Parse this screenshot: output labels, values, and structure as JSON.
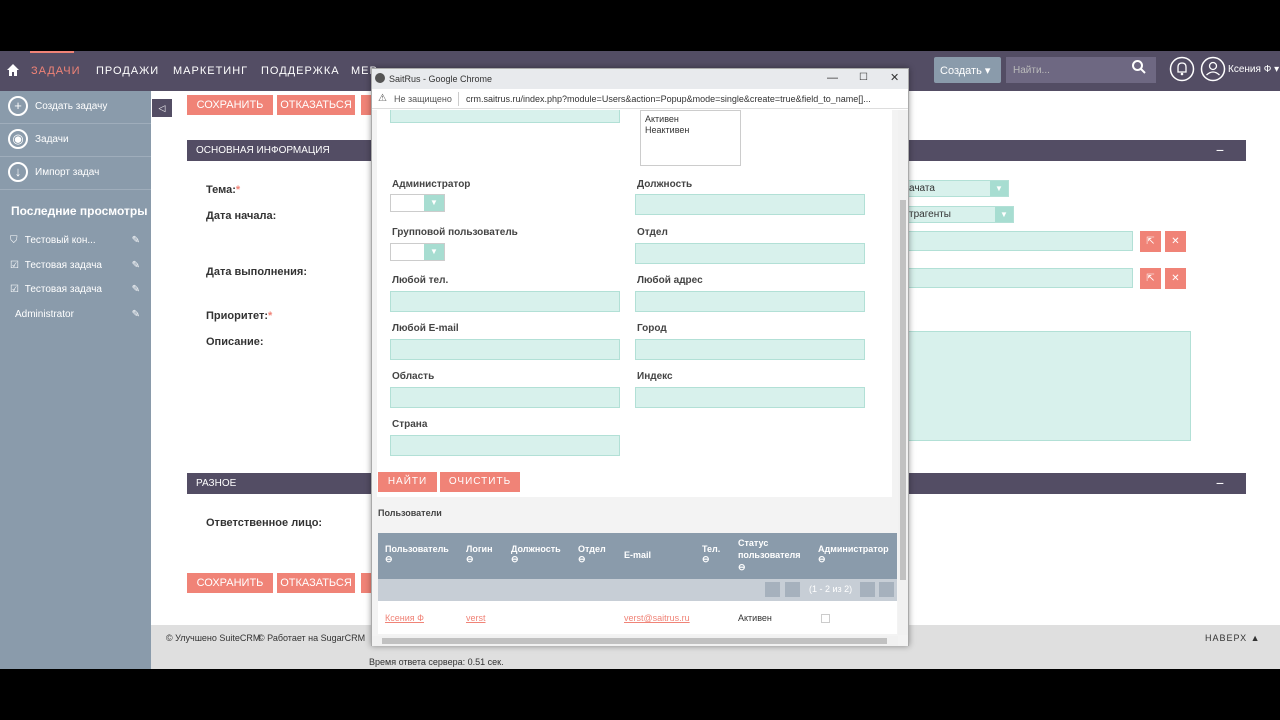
{
  "nav": {
    "items": [
      "ЗАДАЧИ",
      "ПРОДАЖИ",
      "МАРКЕТИНГ",
      "ПОДДЕРЖКА",
      "МЕР"
    ],
    "create_label": "Создать",
    "search_placeholder": "Найти...",
    "user_name": "Ксения Ф"
  },
  "sidebar": {
    "actions": [
      {
        "label": "Создать задачу",
        "icon": "plus-icon"
      },
      {
        "label": "Задачи",
        "icon": "eye-icon"
      },
      {
        "label": "Импорт задач",
        "icon": "download-icon"
      }
    ],
    "recent_title": "Последние просмотры",
    "recent": [
      {
        "label": "Тестовый кон...",
        "icon": "shield-icon"
      },
      {
        "label": "Тестовая задача",
        "icon": "check-icon"
      },
      {
        "label": "Тестовая задача",
        "icon": "check-icon"
      },
      {
        "label": "Administrator",
        "icon": ""
      }
    ]
  },
  "form": {
    "save_label": "СОХРАНИТЬ",
    "cancel_label": "ОТКАЗАТЬСЯ",
    "panel_main": "ОСНОВНАЯ ИНФОРМАЦИЯ",
    "panel_misc": "РАЗНОЕ",
    "labels": {
      "subject": "Тема:",
      "date_start": "Дата начала:",
      "date_due": "Дата выполнения:",
      "priority": "Приоритет:",
      "description": "Описание:",
      "assigned": "Ответственное лицо:"
    },
    "status_value": "ачата",
    "parent_type_value": "трагенты"
  },
  "footer": {
    "left1": "© Улучшено SuiteCRM",
    "left2": "© Работает на SugarCRM",
    "top_label": "НАВЕРХ",
    "server_time": "Время ответа сервера: 0.51 сек."
  },
  "popup": {
    "window_title": "SaitRus - Google Chrome",
    "insecure_label": "Не защищено",
    "url": "crm.saitrus.ru/index.php?module=Users&action=Popup&mode=single&create=true&field_to_name[]...",
    "status_options": [
      "Активен",
      "Неактивен"
    ],
    "labels": {
      "admin": "Администратор",
      "title": "Должность",
      "group_user": "Групповой пользователь",
      "department": "Отдел",
      "any_phone": "Любой тел.",
      "any_address": "Любой адрес",
      "any_email": "Любой E-mail",
      "city": "Город",
      "state": "Область",
      "zip": "Индекс",
      "country": "Страна"
    },
    "find_label": "НАЙТИ",
    "clear_label": "ОЧИСТИТЬ",
    "list_title": "Пользователи",
    "columns": [
      "Пользователь",
      "Логин",
      "Должность",
      "Отдел",
      "E-mail",
      "Тел.",
      "Статус пользователя",
      "Администратор"
    ],
    "pagination": "(1 - 2 из 2)",
    "rows": [
      {
        "user": "Ксения Ф",
        "login": "verst",
        "email": "verst@saitrus.ru",
        "status": "Активен"
      }
    ]
  }
}
